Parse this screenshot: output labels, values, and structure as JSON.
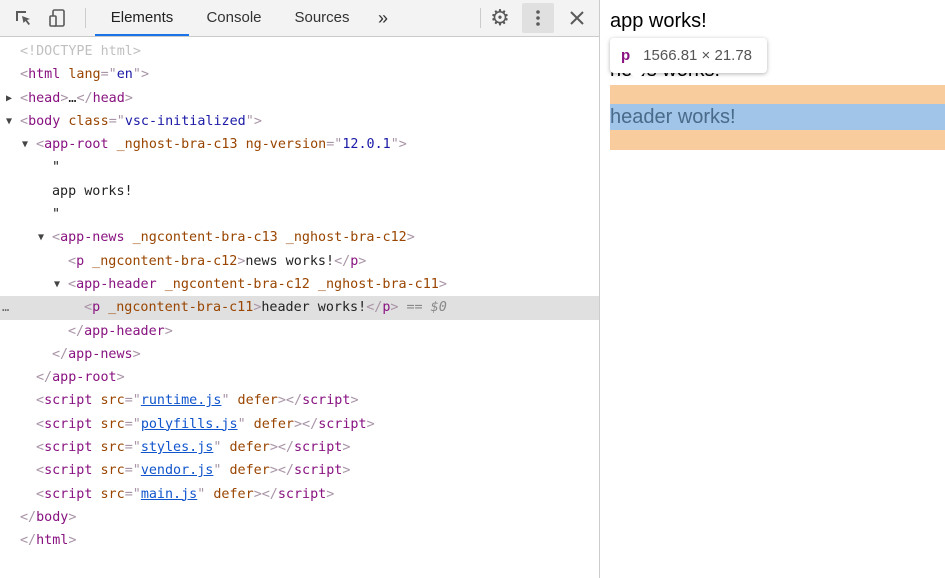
{
  "toolbar": {
    "tabs": [
      {
        "label": "Elements",
        "active": true
      },
      {
        "label": "Console"
      },
      {
        "label": "Sources"
      }
    ],
    "more": "»",
    "icons": [
      "inspect-icon",
      "device-toolbar-icon",
      "settings-icon",
      "more-vertical-icon",
      "close-icon"
    ],
    "accent": "#1a73e8"
  },
  "tree": [
    {
      "lvl": 0,
      "tok": [
        [
          "<!DOCTYPE html>",
          "dc"
        ]
      ]
    },
    {
      "lvl": 0,
      "tok": [
        [
          "<",
          "br"
        ],
        [
          "html",
          "tg"
        ],
        [
          " lang",
          "an"
        ],
        [
          "=\"",
          "br"
        ],
        [
          "en",
          "av"
        ],
        [
          "\"",
          "br"
        ],
        [
          ">",
          "br"
        ]
      ]
    },
    {
      "lvl": 1,
      "arrow": "▶",
      "tok": [
        [
          "<",
          "br"
        ],
        [
          "head",
          "tg"
        ],
        [
          ">",
          "br"
        ],
        [
          "…",
          "tx"
        ],
        [
          "</",
          "br"
        ],
        [
          "head",
          "tg"
        ],
        [
          ">",
          "br"
        ]
      ]
    },
    {
      "lvl": 1,
      "arrow": "▼",
      "tok": [
        [
          "<",
          "br"
        ],
        [
          "body",
          "tg"
        ],
        [
          " class",
          "an"
        ],
        [
          "=\"",
          "br"
        ],
        [
          "vsc-initialized",
          "av"
        ],
        [
          "\"",
          "br"
        ],
        [
          ">",
          "br"
        ]
      ]
    },
    {
      "lvl": 2,
      "arrow": "▼",
      "tok": [
        [
          "<",
          "br"
        ],
        [
          "app-root",
          "tg"
        ],
        [
          " _nghost-bra-c13 ng-version",
          "an"
        ],
        [
          "=\"",
          "br"
        ],
        [
          "12.0.1",
          "av"
        ],
        [
          "\"",
          "br"
        ],
        [
          ">",
          "br"
        ]
      ]
    },
    {
      "lvl": 3,
      "tok": [
        [
          "\"",
          "tx"
        ]
      ]
    },
    {
      "lvl": 3,
      "tok": [
        [
          "app works!",
          "tx"
        ]
      ]
    },
    {
      "lvl": 3,
      "tok": [
        [
          "\"",
          "tx"
        ]
      ]
    },
    {
      "lvl": 3,
      "arrow": "▼",
      "tok": [
        [
          "<",
          "br"
        ],
        [
          "app-news",
          "tg"
        ],
        [
          " _ngcontent-bra-c13 _nghost-bra-c12",
          "an"
        ],
        [
          ">",
          "br"
        ]
      ]
    },
    {
      "lvl": 4,
      "tok": [
        [
          "<",
          "br"
        ],
        [
          "p",
          "tg"
        ],
        [
          " _ngcontent-bra-c12",
          "an"
        ],
        [
          ">",
          "br"
        ],
        [
          "news works!",
          "tx"
        ],
        [
          "</",
          "br"
        ],
        [
          "p",
          "tg"
        ],
        [
          ">",
          "br"
        ]
      ]
    },
    {
      "lvl": 4,
      "arrow": "▼",
      "tok": [
        [
          "<",
          "br"
        ],
        [
          "app-header",
          "tg"
        ],
        [
          " _ngcontent-bra-c12 _nghost-bra-c11",
          "an"
        ],
        [
          ">",
          "br"
        ]
      ]
    },
    {
      "lvl": 5,
      "sel": true,
      "tok": [
        [
          "<",
          "br"
        ],
        [
          "p",
          "tg"
        ],
        [
          " _ngcontent-bra-c11",
          "an"
        ],
        [
          ">",
          "br"
        ],
        [
          "header works!",
          "tx"
        ],
        [
          "</",
          "br"
        ],
        [
          "p",
          "tg"
        ],
        [
          ">",
          "br"
        ],
        [
          " == $0",
          "eq"
        ]
      ]
    },
    {
      "lvl": 4,
      "tok": [
        [
          "</",
          "br"
        ],
        [
          "app-header",
          "tg"
        ],
        [
          ">",
          "br"
        ]
      ]
    },
    {
      "lvl": 3,
      "tok": [
        [
          "</",
          "br"
        ],
        [
          "app-news",
          "tg"
        ],
        [
          ">",
          "br"
        ]
      ]
    },
    {
      "lvl": 2,
      "tok": [
        [
          "</",
          "br"
        ],
        [
          "app-root",
          "tg"
        ],
        [
          ">",
          "br"
        ]
      ]
    },
    {
      "lvl": 2,
      "tok": [
        [
          "<",
          "br"
        ],
        [
          "script",
          "tg"
        ],
        [
          " src",
          "an"
        ],
        [
          "=\"",
          "br"
        ],
        [
          "runtime.js",
          "lk"
        ],
        [
          "\"",
          "br"
        ],
        [
          " defer",
          "an"
        ],
        [
          "></",
          "br"
        ],
        [
          "script",
          "tg"
        ],
        [
          ">",
          "br"
        ]
      ]
    },
    {
      "lvl": 2,
      "tok": [
        [
          "<",
          "br"
        ],
        [
          "script",
          "tg"
        ],
        [
          " src",
          "an"
        ],
        [
          "=\"",
          "br"
        ],
        [
          "polyfills.js",
          "lk"
        ],
        [
          "\"",
          "br"
        ],
        [
          " defer",
          "an"
        ],
        [
          "></",
          "br"
        ],
        [
          "script",
          "tg"
        ],
        [
          ">",
          "br"
        ]
      ]
    },
    {
      "lvl": 2,
      "tok": [
        [
          "<",
          "br"
        ],
        [
          "script",
          "tg"
        ],
        [
          " src",
          "an"
        ],
        [
          "=\"",
          "br"
        ],
        [
          "styles.js",
          "lk"
        ],
        [
          "\"",
          "br"
        ],
        [
          " defer",
          "an"
        ],
        [
          "></",
          "br"
        ],
        [
          "script",
          "tg"
        ],
        [
          ">",
          "br"
        ]
      ]
    },
    {
      "lvl": 2,
      "tok": [
        [
          "<",
          "br"
        ],
        [
          "script",
          "tg"
        ],
        [
          " src",
          "an"
        ],
        [
          "=\"",
          "br"
        ],
        [
          "vendor.js",
          "lk"
        ],
        [
          "\"",
          "br"
        ],
        [
          " defer",
          "an"
        ],
        [
          "></",
          "br"
        ],
        [
          "script",
          "tg"
        ],
        [
          ">",
          "br"
        ]
      ]
    },
    {
      "lvl": 2,
      "tok": [
        [
          "<",
          "br"
        ],
        [
          "script",
          "tg"
        ],
        [
          " src",
          "an"
        ],
        [
          "=\"",
          "br"
        ],
        [
          "main.js",
          "lk"
        ],
        [
          "\"",
          "br"
        ],
        [
          " defer",
          "an"
        ],
        [
          "></",
          "br"
        ],
        [
          "script",
          "tg"
        ],
        [
          ">",
          "br"
        ]
      ]
    },
    {
      "lvl": 1,
      "tok": [
        [
          "</",
          "br"
        ],
        [
          "body",
          "tg"
        ],
        [
          ">",
          "br"
        ]
      ]
    },
    {
      "lvl": 0,
      "tok": [
        [
          "</",
          "br"
        ],
        [
          "html",
          "tg"
        ],
        [
          ">",
          "br"
        ]
      ]
    }
  ],
  "selected_dots": "…",
  "page": {
    "app": "app works!",
    "news": "news works!",
    "header": "header works!"
  },
  "tooltip": {
    "tag": "p",
    "size": "1566.81 × 21.78"
  },
  "colors": {
    "margin": "#f9cc9d",
    "content": "#a0c5e8"
  }
}
